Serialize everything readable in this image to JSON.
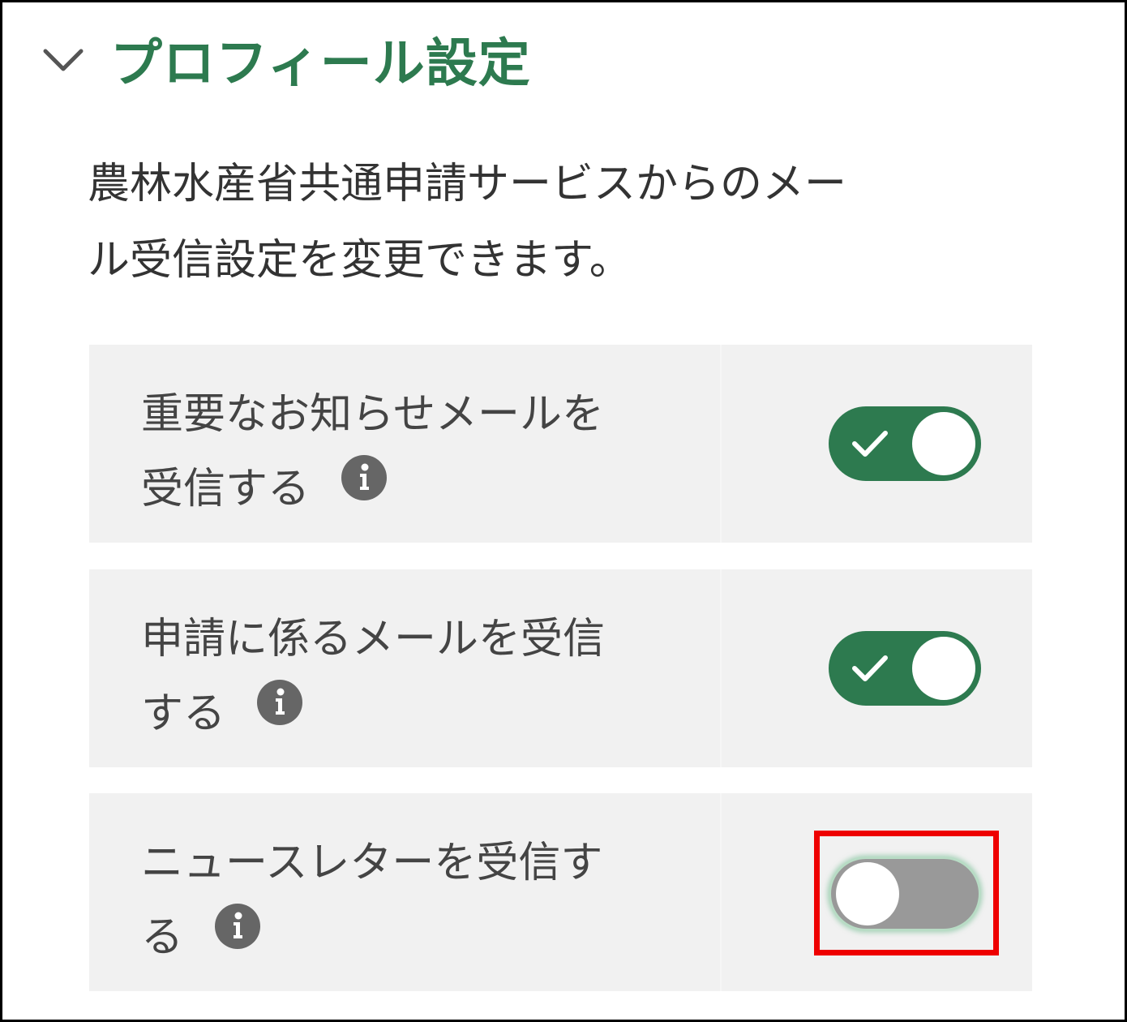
{
  "section": {
    "title": "プロフィール設定",
    "collapse_icon": "chevron-down-icon",
    "description_line1": "農林水産省共通申請サービスからのメー",
    "description_line2": "ル受信設定を変更できます。"
  },
  "settings": [
    {
      "label_line1": "重要なお知らせメールを",
      "label_line2": "受信する",
      "info_icon": "info-icon",
      "enabled": true
    },
    {
      "label_line1": "申請に係るメールを受信",
      "label_line2": "する",
      "info_icon": "info-icon",
      "enabled": true
    },
    {
      "label_line1": "ニュースレターを受信す",
      "label_line2": "る",
      "info_icon": "info-icon",
      "enabled": false
    }
  ],
  "colors": {
    "accent_green": "#2d7a4f",
    "toggle_off": "#999999",
    "row_background": "#f1f1f1",
    "highlight_red": "#ee0000"
  }
}
